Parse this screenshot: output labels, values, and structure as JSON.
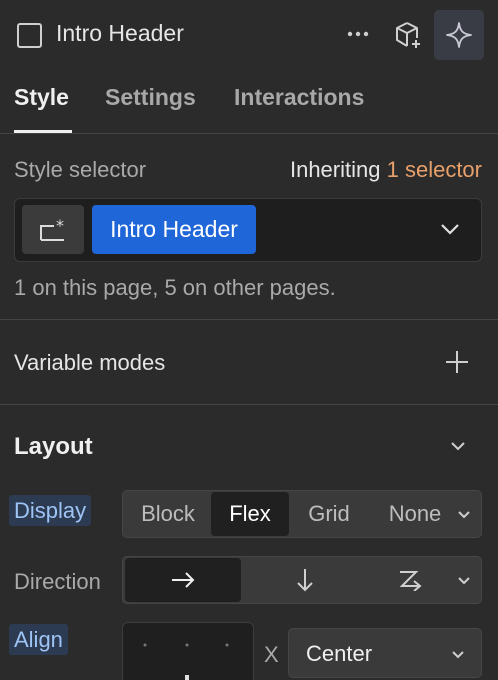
{
  "header": {
    "title": "Intro Header",
    "icons": [
      "element-box-icon",
      "more-icon",
      "add-component-icon",
      "ai-sparkle-icon"
    ]
  },
  "tabs": [
    {
      "label": "Style",
      "active": true
    },
    {
      "label": "Settings",
      "active": false
    },
    {
      "label": "Interactions",
      "active": false
    }
  ],
  "style_selector": {
    "label": "Style selector",
    "inheriting_prefix": "Inheriting",
    "inheriting_link": "1 selector",
    "selected_class": "Intro Header",
    "usage_text": "1 on this page, 5 on other pages."
  },
  "variable_modes": {
    "label": "Variable modes"
  },
  "layout": {
    "title": "Layout",
    "display": {
      "label": "Display",
      "options": [
        "Block",
        "Flex",
        "Grid",
        "None"
      ],
      "selected": "Flex"
    },
    "direction": {
      "label": "Direction",
      "selected": "horizontal"
    },
    "align": {
      "label": "Align",
      "x_label": "X",
      "x_value": "Center"
    }
  },
  "colors": {
    "accent": "#1f66d8",
    "link": "#e8a06a",
    "panel": "#2b2b2b"
  }
}
